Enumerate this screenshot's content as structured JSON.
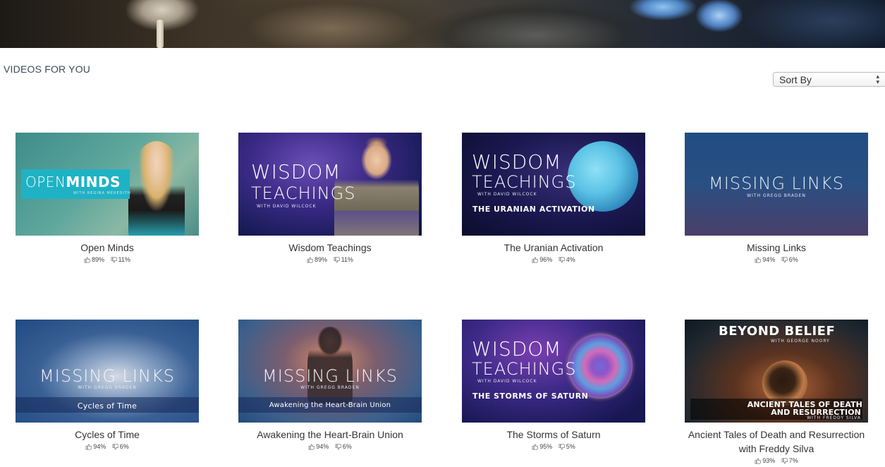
{
  "section": {
    "title": "VIDEOS FOR YOU"
  },
  "sort": {
    "label": "Sort By"
  },
  "videos": [
    {
      "title": "Open Minds",
      "up": "89%",
      "down": "11%",
      "thumb_lines": [
        "OPEN",
        "MINDS",
        "WITH REGINA MEREDITH"
      ]
    },
    {
      "title": "Wisdom Teachings",
      "up": "89%",
      "down": "11%",
      "thumb_lines": [
        "WISDOM",
        "TEACHINGS",
        "WITH DAVID WILCOCK"
      ]
    },
    {
      "title": "The Uranian Activation",
      "up": "96%",
      "down": "4%",
      "thumb_lines": [
        "WISDOM",
        "TEACHINGS",
        "WITH DAVID WILCOCK",
        "THE URANIAN ACTIVATION"
      ]
    },
    {
      "title": "Missing Links",
      "up": "94%",
      "down": "6%",
      "thumb_lines": [
        "MISSING LINKS",
        "WITH GREGG BRADEN"
      ]
    },
    {
      "title": "Cycles of Time",
      "up": "94%",
      "down": "6%",
      "thumb_lines": [
        "MISSING LINKS",
        "WITH GREGG BRADEN",
        "Cycles of Time"
      ]
    },
    {
      "title": "Awakening the Heart-Brain Union",
      "up": "94%",
      "down": "6%",
      "thumb_lines": [
        "MISSING LINKS",
        "WITH GREGG BRADEN",
        "Awakening the Heart-Brain Union"
      ]
    },
    {
      "title": "The Storms of Saturn",
      "up": "95%",
      "down": "5%",
      "thumb_lines": [
        "WISDOM",
        "TEACHINGS",
        "WITH DAVID WILCOCK",
        "THE STORMS OF SATURN"
      ]
    },
    {
      "title": "Ancient Tales of Death and Resurrection with Freddy Silva",
      "up": "93%",
      "down": "7%",
      "thumb_lines": [
        "BEYOND BELIEF",
        "WITH GEORGE NOORY",
        "ANCIENT TALES OF DEATH",
        "AND RESURRECTION",
        "WITH FREDDY SILVA"
      ]
    }
  ]
}
